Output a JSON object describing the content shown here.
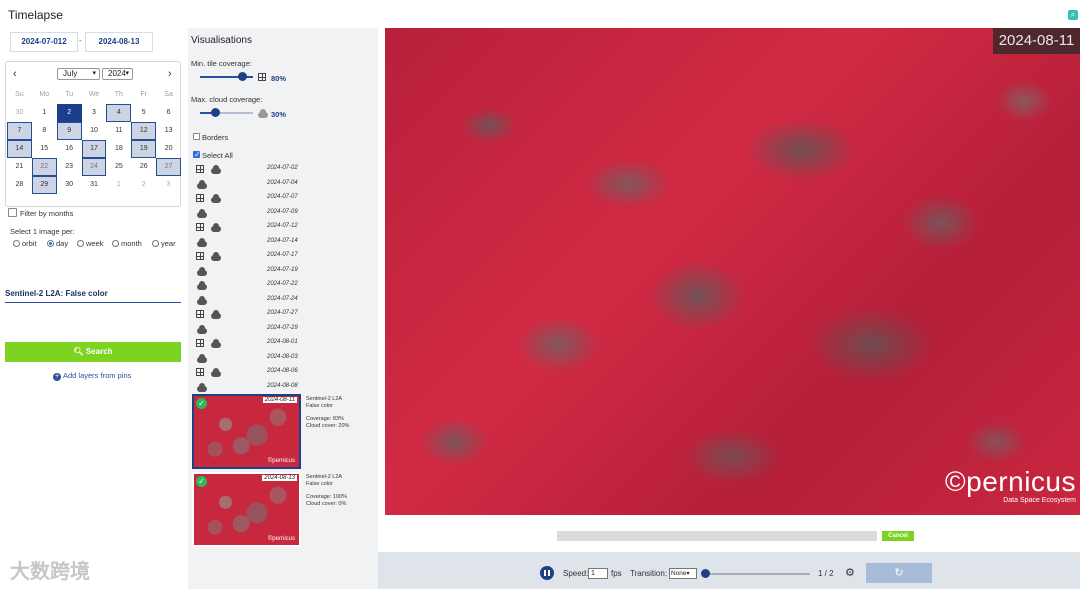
{
  "header": {
    "title": "Timelapse"
  },
  "dates": {
    "from": "2024-07-012",
    "to": "2024-08-13",
    "separator": "-"
  },
  "calendar": {
    "prev": "‹",
    "next": "›",
    "month": "July",
    "year": "2024",
    "weekdays": [
      "Su",
      "Mo",
      "Tu",
      "We",
      "Th",
      "Fr",
      "Sa"
    ],
    "weeks": [
      [
        "30",
        "1",
        "2",
        "3",
        "4",
        "5",
        "6"
      ],
      [
        "7",
        "8",
        "9",
        "10",
        "11",
        "12",
        "13"
      ],
      [
        "14",
        "15",
        "16",
        "17",
        "18",
        "19",
        "20"
      ],
      [
        "21",
        "22",
        "23",
        "24",
        "25",
        "26",
        "27"
      ],
      [
        "28",
        "29",
        "30",
        "31",
        "1",
        "2",
        "3"
      ]
    ]
  },
  "filter_by_months": "Filter by months",
  "select_image": {
    "label": "Select 1 image per:",
    "options": [
      "orbit",
      "day",
      "week",
      "month",
      "year"
    ],
    "selected": "day"
  },
  "layer": "Sentinel-2 L2A: False color",
  "search_label": "Search",
  "add_layers_label": "Add layers from pins",
  "watermark": "大数跨境",
  "visualisations": {
    "title": "Visualisations",
    "min_tile_label": "Min. tile coverage:",
    "min_tile_value": "80%",
    "max_cloud_label": "Max. cloud coverage:",
    "max_cloud_value": "30%",
    "borders_label": "Borders",
    "select_all_label": "Select All"
  },
  "dates_list": [
    {
      "date": "2024-07-02",
      "tile": true,
      "cloud": true
    },
    {
      "date": "2024-07-04",
      "tile": false,
      "cloud": true
    },
    {
      "date": "2024-07-07",
      "tile": true,
      "cloud": true
    },
    {
      "date": "2024-07-09",
      "tile": false,
      "cloud": true
    },
    {
      "date": "2024-07-12",
      "tile": true,
      "cloud": true
    },
    {
      "date": "2024-07-14",
      "tile": false,
      "cloud": true
    },
    {
      "date": "2024-07-17",
      "tile": true,
      "cloud": true
    },
    {
      "date": "2024-07-19",
      "tile": false,
      "cloud": true
    },
    {
      "date": "2024-07-22",
      "tile": false,
      "cloud": true
    },
    {
      "date": "2024-07-24",
      "tile": false,
      "cloud": true
    },
    {
      "date": "2024-07-27",
      "tile": true,
      "cloud": true
    },
    {
      "date": "2024-07-29",
      "tile": false,
      "cloud": true
    },
    {
      "date": "2024-08-01",
      "tile": true,
      "cloud": true
    },
    {
      "date": "2024-08-03",
      "tile": false,
      "cloud": true
    },
    {
      "date": "2024-08-06",
      "tile": true,
      "cloud": true
    },
    {
      "date": "2024-08-08",
      "tile": false,
      "cloud": true
    }
  ],
  "thumbnails": [
    {
      "date": "2024-08-11",
      "title1": "Sentinel-2 L2A",
      "title2": "False color",
      "coverage": "Coverage: 83%",
      "cloud": "Cloud cover: 20%"
    },
    {
      "date": "2024-08-13",
      "title1": "Sentinel-2 L2A",
      "title2": "False color",
      "coverage": "Coverage: 100%",
      "cloud": "Cloud cover: 0%"
    }
  ],
  "thumb_logo": "©pernicus",
  "viewer": {
    "date": "2024-08-11",
    "logo_big": "©pernicus",
    "logo_sub": "Data Space Ecosystem",
    "cancel_label": "Cancel"
  },
  "player": {
    "speed_label": "Speed:",
    "fps_value": "1",
    "fps_unit": "fps",
    "transition_label": "Transition:",
    "transition_value": "None",
    "frame_counter": "1 / 2",
    "position_fraction": 0.0
  },
  "colors": {
    "accent": "#1d3f86",
    "green": "#7ed321",
    "false_color_red": "#c8283e"
  }
}
